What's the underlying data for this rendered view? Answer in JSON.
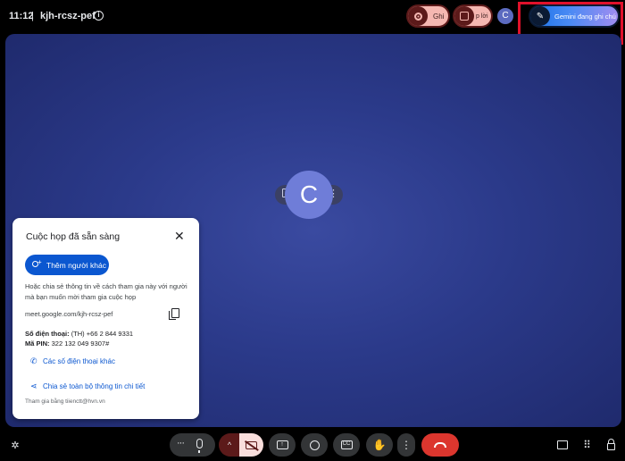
{
  "header": {
    "time": "11:12",
    "separator": "|",
    "meeting_code": "kjh-rcsz-pef",
    "info_icon": "info-icon",
    "record_label": "Ghi",
    "caption_label": "p lời",
    "avatar_initial": "C",
    "gemini_label": "Gemini đang ghi chú"
  },
  "stage": {
    "participant_initial": "C",
    "background_color": "#2b3a8a"
  },
  "card": {
    "title": "Cuộc họp đã sẵn sàng",
    "close_glyph": "✕",
    "add_people_label": "Thêm người khác",
    "description": "Hoặc chia sẻ thông tin về cách tham gia này với người mà bạn muốn mời tham gia cuộc họp",
    "meeting_url": "meet.google.com/kjh-rcsz-pef",
    "phone_label": "Số điện thoại:",
    "phone_value": "(TH) +66 2 844 9331",
    "pin_label": "Mã PIN:",
    "pin_value": "322 132 049 9307#",
    "more_phones_label": "Các số điện thoại khác",
    "share_details_label": "Chia sẻ toàn bộ thông tin chi tiết",
    "joined_as": "Tham gia bằng tiienctt@hvn.vn"
  },
  "toolbar": {
    "more_dots": "···",
    "caret": "^",
    "present_glyph": "↑",
    "cc_glyph": "CC",
    "hand_glyph": "✋",
    "more_vert": "⋮",
    "apps_glyph": "⠿",
    "sparkle_glyph": "✲",
    "leave_color": "#dc362e"
  },
  "colors": {
    "accent": "#0b57d0",
    "record_pill": "#f5b7b1",
    "highlight_box": "#e0112b"
  }
}
